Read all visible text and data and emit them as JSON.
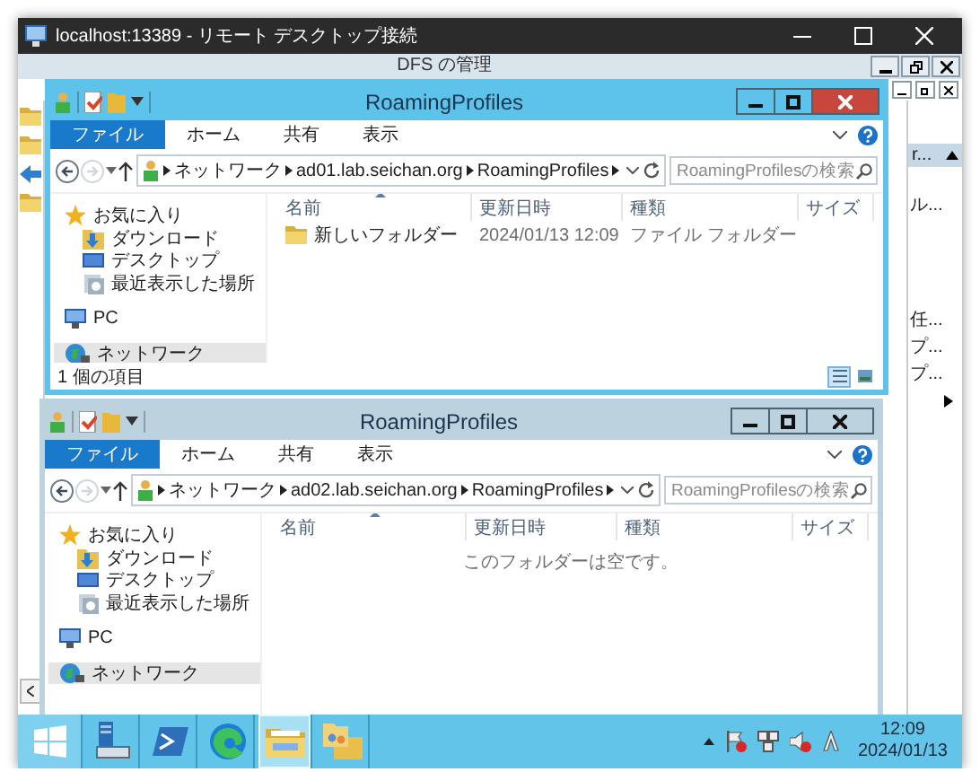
{
  "rdp_window": {
    "title": "localhost:13389 - リモート デスクトップ接続"
  },
  "background_window": {
    "title": "DFS の管理",
    "side_texts": [
      {
        "text": "r...",
        "kind": "header"
      },
      {
        "text": "ル...",
        "kind": "item"
      },
      {
        "text": "任...",
        "kind": "item"
      },
      {
        "text": "プ...",
        "kind": "item"
      },
      {
        "text": "プ...",
        "kind": "item"
      }
    ]
  },
  "explorer_windows": [
    {
      "title": "RoamingProfiles",
      "active": true,
      "ribbon_tabs": [
        {
          "label": "ファイル",
          "selected": true
        },
        {
          "label": "ホーム",
          "selected": false
        },
        {
          "label": "共有",
          "selected": false
        },
        {
          "label": "表示",
          "selected": false
        }
      ],
      "breadcrumb": [
        "ネットワーク",
        "ad01.lab.seichan.org",
        "RoamingProfiles"
      ],
      "search": {
        "placeholder": "RoamingProfilesの検索"
      },
      "nav": [
        {
          "label": "お気に入り",
          "kind": "favorites",
          "selected": false,
          "children": [
            {
              "label": "ダウンロード",
              "kind": "downloads",
              "selected": false
            },
            {
              "label": "デスクトップ",
              "kind": "desktop",
              "selected": false
            },
            {
              "label": "最近表示した場所",
              "kind": "recent",
              "selected": false
            }
          ]
        },
        {
          "label": "PC",
          "kind": "pc",
          "selected": false
        },
        {
          "label": "ネットワーク",
          "kind": "network",
          "selected": true
        }
      ],
      "columns": [
        {
          "label": "名前",
          "sorted": true
        },
        {
          "label": "更新日時",
          "sorted": false
        },
        {
          "label": "種類",
          "sorted": false
        },
        {
          "label": "サイズ",
          "sorted": false
        }
      ],
      "rows": [
        {
          "name": "新しいフォルダー",
          "modified": "2024/01/13 12:09",
          "type": "ファイル フォルダー"
        }
      ],
      "status": {
        "text": "1 個の項目",
        "views": [
          {
            "kind": "details",
            "selected": true
          },
          {
            "kind": "thumbnails",
            "selected": false
          }
        ]
      }
    },
    {
      "title": "RoamingProfiles",
      "active": false,
      "ribbon_tabs": [
        {
          "label": "ファイル",
          "selected": true
        },
        {
          "label": "ホーム",
          "selected": false
        },
        {
          "label": "共有",
          "selected": false
        },
        {
          "label": "表示",
          "selected": false
        }
      ],
      "breadcrumb": [
        "ネットワーク",
        "ad02.lab.seichan.org",
        "RoamingProfiles"
      ],
      "search": {
        "placeholder": "RoamingProfilesの検索"
      },
      "nav": [
        {
          "label": "お気に入り",
          "kind": "favorites",
          "selected": false,
          "children": [
            {
              "label": "ダウンロード",
              "kind": "downloads",
              "selected": false
            },
            {
              "label": "デスクトップ",
              "kind": "desktop",
              "selected": false
            },
            {
              "label": "最近表示した場所",
              "kind": "recent",
              "selected": false
            }
          ]
        },
        {
          "label": "PC",
          "kind": "pc",
          "selected": false
        },
        {
          "label": "ネットワーク",
          "kind": "network",
          "selected": true
        }
      ],
      "columns": [
        {
          "label": "名前",
          "sorted": true
        },
        {
          "label": "更新日時",
          "sorted": false
        },
        {
          "label": "種類",
          "sorted": false
        },
        {
          "label": "サイズ",
          "sorted": false
        }
      ],
      "empty_message": "このフォルダーは空です。"
    }
  ],
  "taskbar": {
    "apps": [
      {
        "kind": "start",
        "active": false
      },
      {
        "kind": "server-manager",
        "active": false
      },
      {
        "kind": "powershell",
        "active": false
      },
      {
        "kind": "edge",
        "active": false
      },
      {
        "kind": "explorer",
        "active": true
      },
      {
        "kind": "dfs",
        "active": false
      }
    ],
    "clock": {
      "time": "12:09",
      "date": "2024/01/13"
    }
  }
}
